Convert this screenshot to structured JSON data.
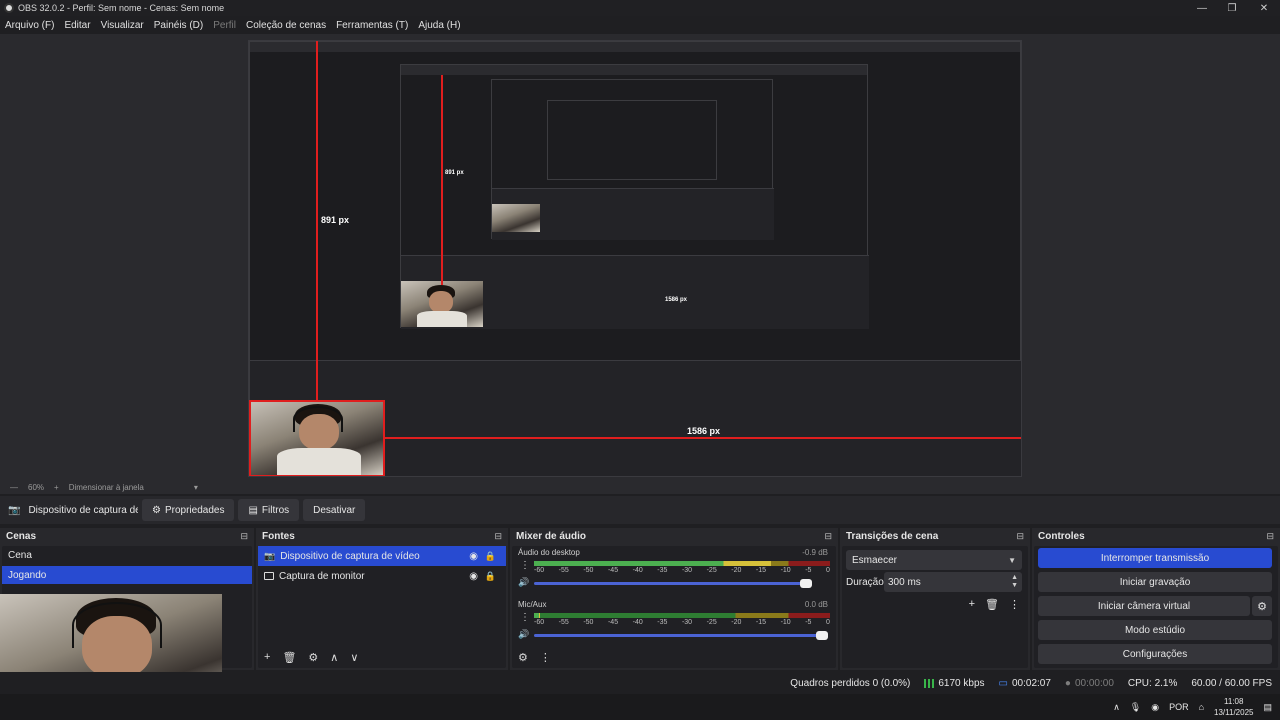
{
  "window": {
    "title": "OBS 32.0.2 - Perfil: Sem nome - Cenas: Sem nome",
    "minimize_icon": "—",
    "restore_icon": "❐",
    "close_icon": "✕"
  },
  "menu": [
    {
      "label": "Arquivo (F)",
      "disabled": false
    },
    {
      "label": "Editar",
      "disabled": false
    },
    {
      "label": "Visualizar",
      "disabled": false
    },
    {
      "label": "Painéis (D)",
      "disabled": false
    },
    {
      "label": "Perfil",
      "disabled": true
    },
    {
      "label": "Coleção de cenas",
      "disabled": false
    },
    {
      "label": "Ferramentas (T)",
      "disabled": false
    },
    {
      "label": "Ajuda (H)",
      "disabled": false
    }
  ],
  "preview": {
    "measure_vertical": "891 px",
    "measure_horizontal": "1586 px",
    "nested_measure_vertical": "891 px",
    "nested_measure_horizontal": "1586 px"
  },
  "zoom_bar": {
    "minus": "—",
    "zoom": "60%",
    "plus": "+",
    "resize_label": "Dimensionar à janela",
    "arrow": "▾"
  },
  "toolbar": {
    "source_name": "Dispositivo de captura de v",
    "properties_label": "Propriedades",
    "filters_label": "Filtros",
    "deactivate_label": "Desativar"
  },
  "scenes": {
    "title": "Cenas",
    "items": [
      {
        "label": "Cena",
        "selected": false
      },
      {
        "label": "Jogando",
        "selected": true
      }
    ]
  },
  "sources": {
    "title": "Fontes",
    "items": [
      {
        "label": "Dispositivo de captura de vídeo",
        "selected": true
      },
      {
        "label": "Captura de monitor",
        "selected": false
      }
    ],
    "footer": [
      "+",
      "🗑",
      "⚙",
      "∧",
      "∨"
    ]
  },
  "mixer": {
    "title": "Mixer de áudio",
    "tracks": [
      {
        "name": "Áudio do desktop",
        "db": "-0.9 dB",
        "level": 0.8
      },
      {
        "name": "Mic/Aux",
        "db": "0.0 dB",
        "level": 0.02
      }
    ],
    "scale": [
      "-60",
      "-55",
      "-50",
      "-45",
      "-40",
      "-35",
      "-30",
      "-25",
      "-20",
      "-15",
      "-10",
      "-5",
      "0"
    ]
  },
  "transitions": {
    "title": "Transições de cena",
    "selected": "Esmaecer",
    "duration_label": "Duração",
    "duration_value": "300 ms"
  },
  "controls": {
    "title": "Controles",
    "buttons": [
      {
        "label": "Interromper transmissão",
        "primary": true
      },
      {
        "label": "Iniciar gravação",
        "primary": false
      },
      {
        "label": "Iniciar câmera virtual",
        "primary": false
      },
      {
        "label": "Modo estúdio",
        "primary": false
      },
      {
        "label": "Configurações",
        "primary": false
      }
    ]
  },
  "status": {
    "dropped_frames": "Quadros perdidos 0 (0.0%)",
    "bitrate": "6170 kbps",
    "stream_time": "00:02:07",
    "rec_time": "00:00:00",
    "cpu": "CPU: 2.1%",
    "fps": "60.00 / 60.00 FPS"
  },
  "taskbar": {
    "lang": "POR",
    "time": "11:08",
    "date": "13/11/2025"
  },
  "colors": {
    "accent": "#284bd1",
    "red_guide": "#e01e1e",
    "background": "#1f1f22"
  }
}
